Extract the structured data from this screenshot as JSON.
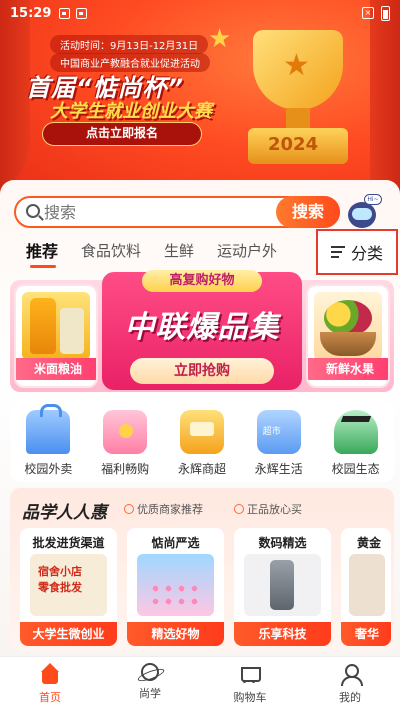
{
  "status_bar": {
    "time": "15:29"
  },
  "hero": {
    "date_line": "活动时间：9月13日-12月31日",
    "org_line": "中国商业产教融合就业促进活动",
    "headline": "首届“惦尚杯”",
    "subline": "大学生就业创业大赛",
    "signup_button": "点击立即报名",
    "year": "2024"
  },
  "search": {
    "placeholder": "搜索",
    "button": "搜索",
    "assistant_bubble": "Hi~"
  },
  "tabs": [
    {
      "label": "推荐"
    },
    {
      "label": "食品饮料"
    },
    {
      "label": "生鲜"
    },
    {
      "label": "运动户外"
    }
  ],
  "category_button": "分类",
  "promo": {
    "tagline": "高复购好物",
    "title": "中联爆品集",
    "cta": "立即抢购",
    "left_label": "米面粮油",
    "right_label": "新鲜水果"
  },
  "services": [
    {
      "label": "校园外卖"
    },
    {
      "label": "福利畅购"
    },
    {
      "label": "永辉商超"
    },
    {
      "label": "永辉生活"
    },
    {
      "label": "校园生态"
    }
  ],
  "section": {
    "title": "品学人人惠",
    "badge1": "优质商家推荐",
    "badge2": "正品放心买",
    "cards": [
      {
        "title": "批发进货渠道",
        "footer": "大学生微创业"
      },
      {
        "title": "惦尚严选",
        "footer": "精选好物"
      },
      {
        "title": "数码精选",
        "footer": "乐享科技"
      },
      {
        "title": "黄金",
        "footer": "奢华"
      }
    ]
  },
  "bottom_nav": [
    {
      "label": "首页"
    },
    {
      "label": "尚学"
    },
    {
      "label": "购物车"
    },
    {
      "label": "我的"
    }
  ],
  "colors": {
    "accent": "#ff4a1c",
    "highlight_box": "#e53a2e"
  }
}
